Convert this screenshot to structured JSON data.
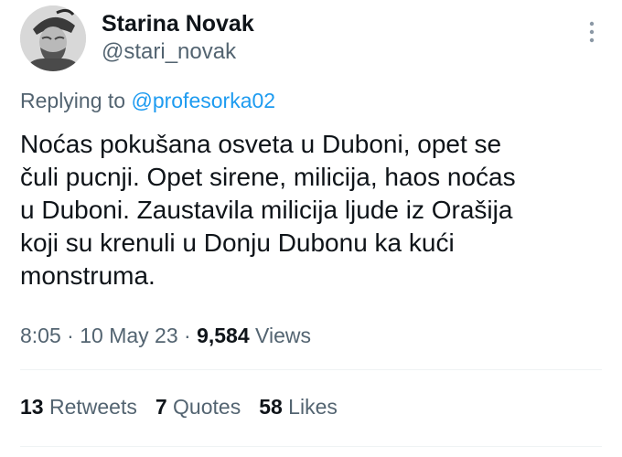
{
  "user": {
    "display_name": "Starina Novak",
    "handle": "@stari_novak",
    "avatar_icon": "portrait-avatar"
  },
  "menu_icon": "more-vertical-icon",
  "reply": {
    "prefix": "Replying to",
    "mention": "@profesorka02"
  },
  "tweet": {
    "lines": [
      "Noćas pokušana osveta u Duboni, opet se",
      "čuli pucnji. Opet sirene, milicija, haos noćas",
      "u Duboni. Zaustavila milicija ljude iz Orašija",
      "koji su krenuli u Donju Dubonu ka kući",
      "monstruma."
    ]
  },
  "meta": {
    "time": "8:05",
    "sep1": " · ",
    "date": "10 May 23",
    "sep2": " · ",
    "views_count": "9,584",
    "views_label": " Views"
  },
  "stats": {
    "retweets_count": "13",
    "retweets_label": " Retweets",
    "quotes_count": "7",
    "quotes_label": " Quotes",
    "likes_count": "58",
    "likes_label": " Likes"
  },
  "colors": {
    "text": "#0f1419",
    "secondary": "#536471",
    "accent": "#1d9bf0",
    "divider": "#eff3f4"
  }
}
